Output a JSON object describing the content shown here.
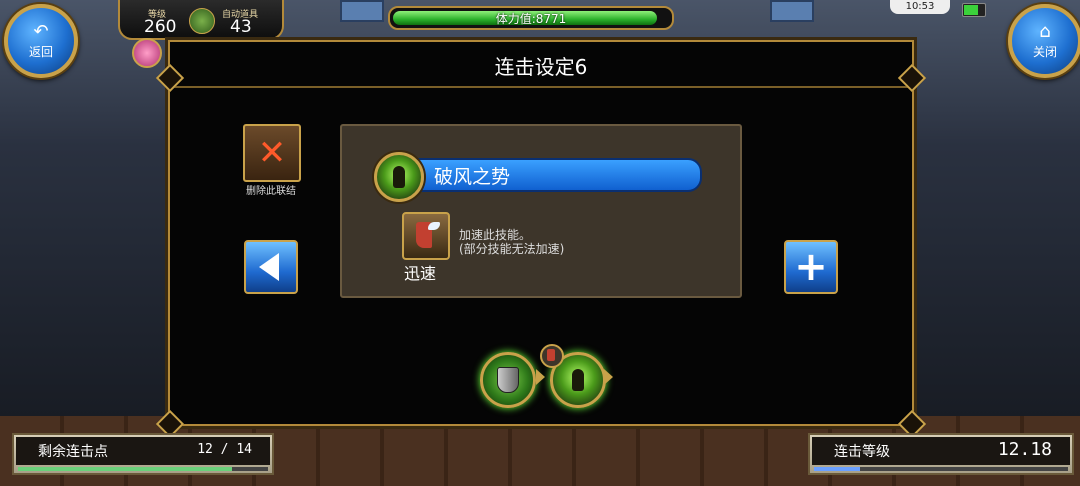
{
  "header": {
    "back_label": "返回",
    "close_label": "关闭",
    "level_label": "等级",
    "level_value": "260",
    "auto_label": "自动道具",
    "auto_value": "43",
    "stamina_text": "体力值:8771",
    "stamina_fraction": 0.97,
    "clock": "10:53"
  },
  "panel": {
    "title": "连击设定6",
    "delete_label": "删除此联结",
    "skill_name": "破风之势",
    "speed_name": "迅速",
    "speed_desc_line1": "加速此技能。",
    "speed_desc_line2": "(部分技能无法加速)"
  },
  "bottom": {
    "points_label": "剩余连击点",
    "points_value": "12 / 14",
    "points_fraction": 0.857,
    "level_label": "连击等级",
    "level_value": "12.18",
    "level_fraction": 0.18
  },
  "colors": {
    "accent_gold": "#c9a24a",
    "button_blue": "#1f6ad0",
    "skill_bar_blue": "#3aa0ff",
    "stamina_green": "#2bb02b"
  },
  "icons": {
    "back": "back-arrow-icon",
    "close": "home-icon",
    "delete": "close-x-icon",
    "prev": "triangle-left-icon",
    "add": "plus-icon"
  }
}
